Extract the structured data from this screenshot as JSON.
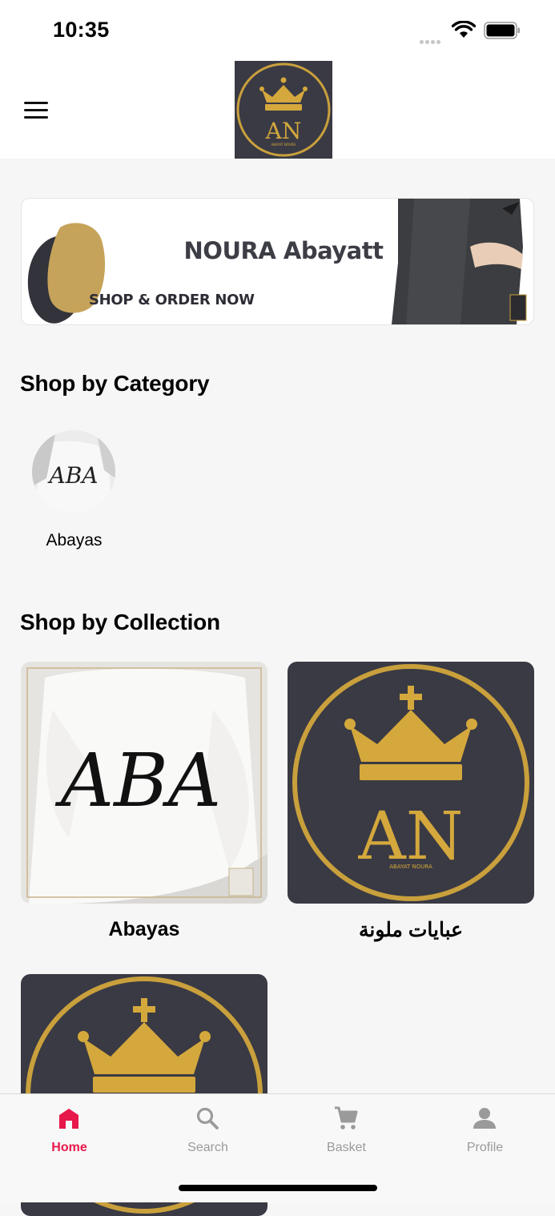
{
  "status_bar": {
    "time": "10:35"
  },
  "header": {
    "menu_icon": "hamburger-menu-icon",
    "logo": {
      "monogram": "AN",
      "caption": "ABAYAT NOURA"
    }
  },
  "banner": {
    "title": "NOURA Abayatt",
    "subtitle": "SHOP & ORDER NOW"
  },
  "categories": {
    "title": "Shop by Category",
    "items": [
      {
        "label": "Abayas",
        "thumb_text": "ABA"
      }
    ]
  },
  "collections": {
    "title": "Shop by Collection",
    "items": [
      {
        "label": "Abayas",
        "thumb_text": "ABA"
      },
      {
        "label": "عبايات ملونة",
        "thumb_text": "AN",
        "thumb_caption": "ABAYAT NOURA"
      },
      {
        "label": "",
        "thumb_text": ""
      }
    ]
  },
  "tab_bar": {
    "tabs": [
      {
        "label": "Home",
        "icon": "home-icon",
        "active": true
      },
      {
        "label": "Search",
        "icon": "search-icon",
        "active": false
      },
      {
        "label": "Basket",
        "icon": "cart-icon",
        "active": false
      },
      {
        "label": "Profile",
        "icon": "user-icon",
        "active": false
      }
    ]
  },
  "colors": {
    "accent": "#e8174b",
    "logo_bg": "#3a3a44",
    "gold": "#c9a03c"
  }
}
